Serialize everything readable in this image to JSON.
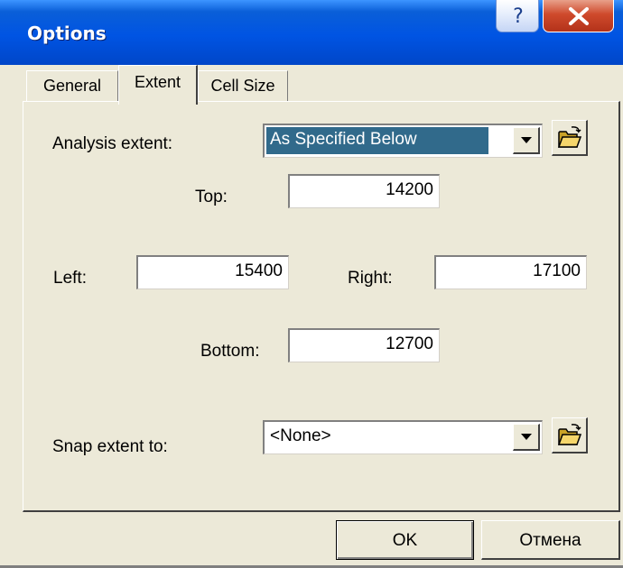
{
  "window": {
    "title": "Options",
    "help_glyph": "?",
    "close_icon": "close-x-icon"
  },
  "tabs": [
    {
      "label": "General",
      "active": false
    },
    {
      "label": "Extent",
      "active": true
    },
    {
      "label": "Cell Size",
      "active": false
    }
  ],
  "extent": {
    "analysis_label": "Analysis extent:",
    "analysis_value": "As Specified Below",
    "top_label": "Top:",
    "top_value": "14200",
    "left_label": "Left:",
    "left_value": "15400",
    "right_label": "Right:",
    "right_value": "17100",
    "bottom_label": "Bottom:",
    "bottom_value": "12700",
    "snap_label": "Snap extent to:",
    "snap_value": "<None>"
  },
  "buttons": {
    "ok": "OK",
    "cancel": "Отмена"
  },
  "colors": {
    "title_bar": "#0054e3",
    "selection": "#316a8b",
    "dialog_face": "#ece9d8"
  }
}
